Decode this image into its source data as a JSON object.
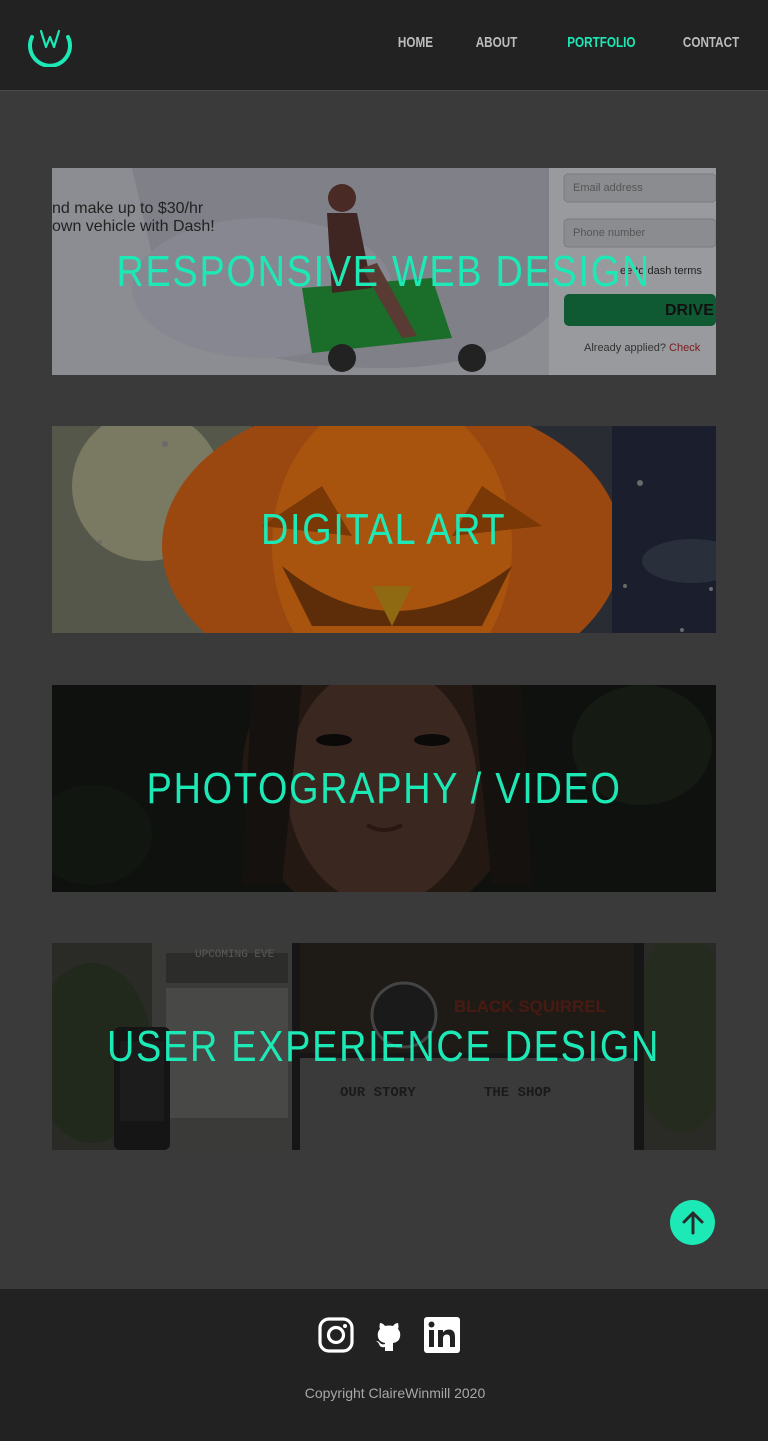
{
  "header": {
    "logo_icon": "w-moon-logo-icon",
    "nav": [
      {
        "label": "HOME",
        "active": false
      },
      {
        "label": "ABOUT",
        "active": false
      },
      {
        "label": "PORTFOLIO",
        "active": true
      },
      {
        "label": "CONTACT",
        "active": false
      }
    ]
  },
  "portfolio": [
    {
      "title": "RESPONSIVE WEB DESIGN",
      "image_text": {
        "line1": "nd make up to $30/hr",
        "line2": "own vehicle with Dash!",
        "email_placeholder": "Email address",
        "phone_placeholder": "Phone number",
        "terms": "ee to dash terms",
        "button": "DRIVE",
        "applied": "Already applied?",
        "check": "Check"
      }
    },
    {
      "title": "DIGITAL ART"
    },
    {
      "title": "PHOTOGRAPHY / VIDEO"
    },
    {
      "title": "USER EXPERIENCE DESIGN",
      "image_text": {
        "upcoming": "UPCOMING EVE",
        "brand": "BLACK SQUIRREL",
        "our_story": "OUR STORY",
        "the_shop": "THE SHOP"
      }
    }
  ],
  "to_top_icon": "arrow-up-icon",
  "footer": {
    "social": [
      {
        "name": "instagram-icon"
      },
      {
        "name": "github-icon"
      },
      {
        "name": "linkedin-icon"
      }
    ],
    "copyright": "Copyright ClaireWinmill 2020"
  },
  "colors": {
    "accent": "#1de9b6",
    "header_bg": "#222222",
    "page_bg": "#3a3a3a",
    "nav_text": "#bdbdbd"
  }
}
